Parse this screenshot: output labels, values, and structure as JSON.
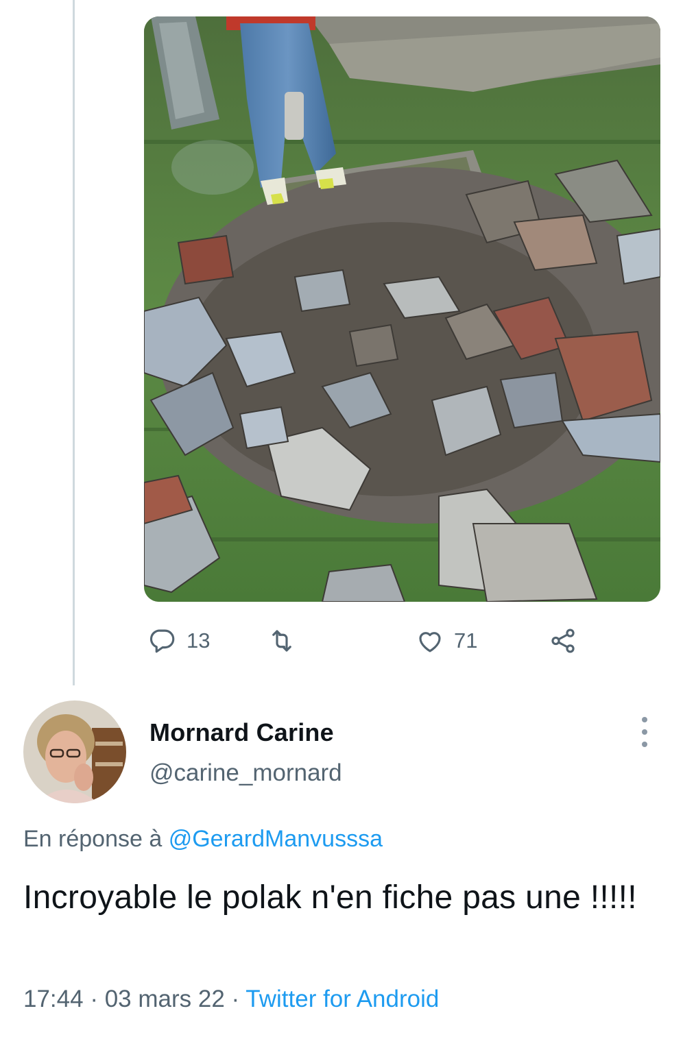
{
  "previous_tweet": {
    "media_description_icon": "photo",
    "actions": {
      "reply_count": "13",
      "retweet_count": "",
      "like_count": "71"
    },
    "icons": {
      "reply": "reply-icon",
      "retweet": "retweet-icon",
      "like": "heart-icon",
      "share": "share-icon"
    }
  },
  "tweet": {
    "author": {
      "display_name": "Mornard Carine",
      "handle": "@carine_mornard"
    },
    "reply_prefix": "En réponse à ",
    "reply_to_handle": "@GerardManvusssa",
    "text": "Incroyable le polak n'en fiche pas une !!!!!",
    "time": "17:44",
    "separator1": " · ",
    "date": "03 mars 22",
    "separator2": " · ",
    "source": "Twitter for Android"
  },
  "colors": {
    "link": "#1d9bf0",
    "secondary_text": "#536471",
    "thread_line": "#cfd9de"
  }
}
